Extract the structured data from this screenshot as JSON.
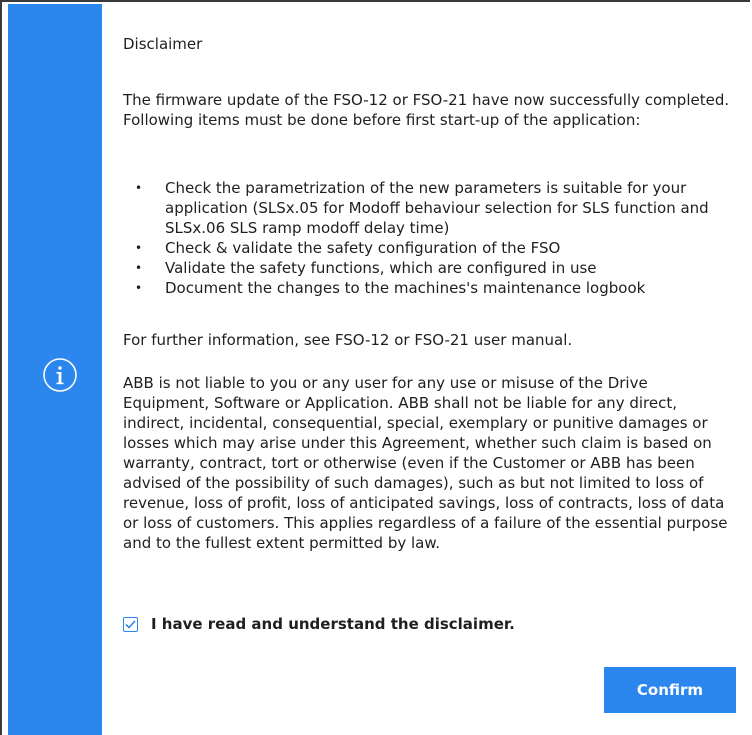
{
  "dialog": {
    "title": "Disclaimer",
    "intro": "The firmware update of the FSO-12 or FSO-21 have now successfully completed. Following items must be done before first start-up of the application:",
    "items": [
      "Check the parametrization of the new parameters is suitable for your application (SLSx.05 for Modoff behaviour selection for SLS function and SLSx.06 SLS ramp modoff delay time)",
      "Check & validate the safety configuration of the FSO",
      "Validate the safety functions, which are configured in use",
      "Document the changes to the machines's maintenance logbook"
    ],
    "further_info": "For further information, see FSO-12 or FSO-21 user manual.",
    "liability": "ABB is not liable to you or any user for any use or misuse of the Drive Equipment, Software or Application. ABB shall not be liable for any direct, indirect, incidental, consequential, special, exemplary or punitive damages or losses which may arise under this Agreement, whether such claim is based on warranty, contract, tort or otherwise (even if the Customer or ABB has been advised of the possibility of such damages), such as but not limited to loss of revenue, loss of profit, loss of anticipated savings, loss of contracts, loss of data or loss of customers. This applies regardless of a failure of the essential purpose and to the fullest extent permitted by law.",
    "checkbox_label": "I have read and understand the disclaimer.",
    "checkbox_checked": true,
    "confirm_label": "Confirm"
  },
  "icons": {
    "side": "info-icon",
    "checkbox": "checkmark-icon"
  },
  "colors": {
    "accent": "#2b86ee",
    "text": "#1f1f1f",
    "border": "#3a3a3a"
  }
}
